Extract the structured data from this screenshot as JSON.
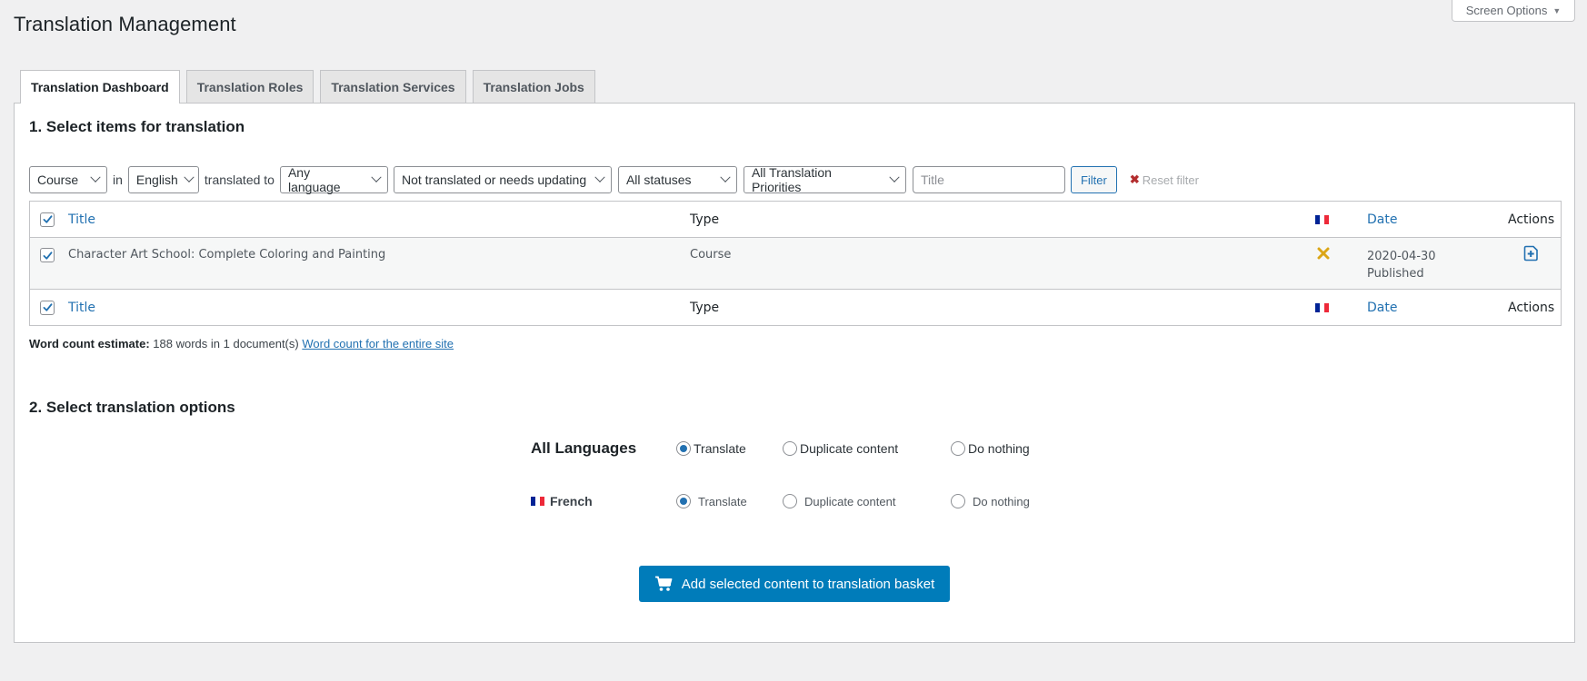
{
  "page": {
    "title": "Translation Management",
    "screen_options": "Screen Options"
  },
  "tabs": [
    {
      "label": "Translation Dashboard",
      "active": true
    },
    {
      "label": "Translation Roles",
      "active": false
    },
    {
      "label": "Translation Services",
      "active": false
    },
    {
      "label": "Translation Jobs",
      "active": false
    }
  ],
  "section1": {
    "title": "1. Select items for translation",
    "filters": {
      "post_type": "Course",
      "in_label": "in",
      "source_language": "English",
      "translated_to_label": "translated to",
      "target_language": "Any language",
      "translation_status": "Not translated or needs updating",
      "post_status": "All statuses",
      "priority": "All Translation Priorities",
      "title_placeholder": "Title",
      "title_value": "",
      "filter_button": "Filter",
      "reset_filter": "Reset filter"
    },
    "table": {
      "columns": {
        "title": "Title",
        "type": "Type",
        "language_flag": "French",
        "date": "Date",
        "actions": "Actions"
      },
      "select_all_checked": true,
      "rows": [
        {
          "checked": true,
          "title": "Character Art School: Complete Coloring and Painting",
          "type": "Course",
          "french_status": "not-translated",
          "date": "2020-04-30",
          "status": "Published",
          "action": "add-translation-icon"
        }
      ]
    },
    "word_count": {
      "label": "Word count estimate:",
      "text": "188 words in 1 document(s)",
      "link": "Word count for the entire site"
    }
  },
  "section2": {
    "title": "2. Select translation options",
    "rows": [
      {
        "language": "All Languages",
        "options": [
          "Translate",
          "Duplicate content",
          "Do nothing"
        ],
        "selected": "Translate"
      },
      {
        "language": "French",
        "options": [
          "Translate",
          "Duplicate content",
          "Do nothing"
        ],
        "selected": "Translate"
      }
    ],
    "submit_button": "Add selected content to translation basket"
  },
  "colors": {
    "accent": "#2271b1",
    "primary_button": "#007cba",
    "not_translated_icon": "#dba617",
    "reset_x": "#b32d2e"
  }
}
